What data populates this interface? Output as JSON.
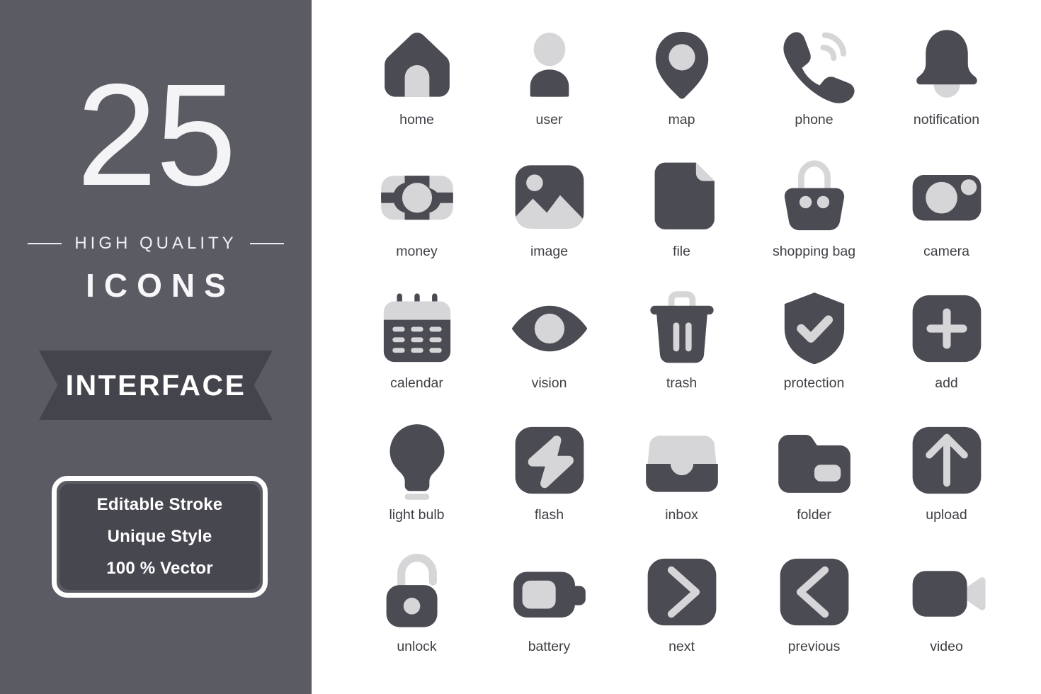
{
  "sidebar": {
    "count": "25",
    "tagline": "HIGH QUALITY",
    "word": "ICONS",
    "ribbon_label": "INTERFACE",
    "features": [
      "Editable Stroke",
      "Unique Style",
      "100 % Vector"
    ],
    "colors": {
      "background": "#5b5b64",
      "ribbon": "#44444c",
      "feature_box": "#474750",
      "text": "#ffffff"
    }
  },
  "icon_set": {
    "colors": {
      "dark": "#4b4b53",
      "light": "#d6d6d8",
      "canvas": "#ffffff",
      "label": "#3f3f46"
    },
    "columns": 5,
    "rows": 5,
    "total": 25,
    "icons": [
      {
        "name": "home-icon",
        "label": "home"
      },
      {
        "name": "user-icon",
        "label": "user"
      },
      {
        "name": "map-icon",
        "label": "map"
      },
      {
        "name": "phone-icon",
        "label": "phone"
      },
      {
        "name": "notification-icon",
        "label": "notification"
      },
      {
        "name": "money-icon",
        "label": "money"
      },
      {
        "name": "image-icon",
        "label": "image"
      },
      {
        "name": "file-icon",
        "label": "file"
      },
      {
        "name": "shopping-bag-icon",
        "label": "shopping bag"
      },
      {
        "name": "camera-icon",
        "label": "camera"
      },
      {
        "name": "calendar-icon",
        "label": "calendar"
      },
      {
        "name": "vision-icon",
        "label": "vision"
      },
      {
        "name": "trash-icon",
        "label": "trash"
      },
      {
        "name": "protection-icon",
        "label": "protection"
      },
      {
        "name": "add-icon",
        "label": "add"
      },
      {
        "name": "light-bulb-icon",
        "label": "light bulb"
      },
      {
        "name": "flash-icon",
        "label": "flash"
      },
      {
        "name": "inbox-icon",
        "label": "inbox"
      },
      {
        "name": "folder-icon",
        "label": "folder"
      },
      {
        "name": "upload-icon",
        "label": "upload"
      },
      {
        "name": "unlock-icon",
        "label": "unlock"
      },
      {
        "name": "battery-icon",
        "label": "battery"
      },
      {
        "name": "next-icon",
        "label": "next"
      },
      {
        "name": "previous-icon",
        "label": "previous"
      },
      {
        "name": "video-icon",
        "label": "video"
      }
    ]
  }
}
